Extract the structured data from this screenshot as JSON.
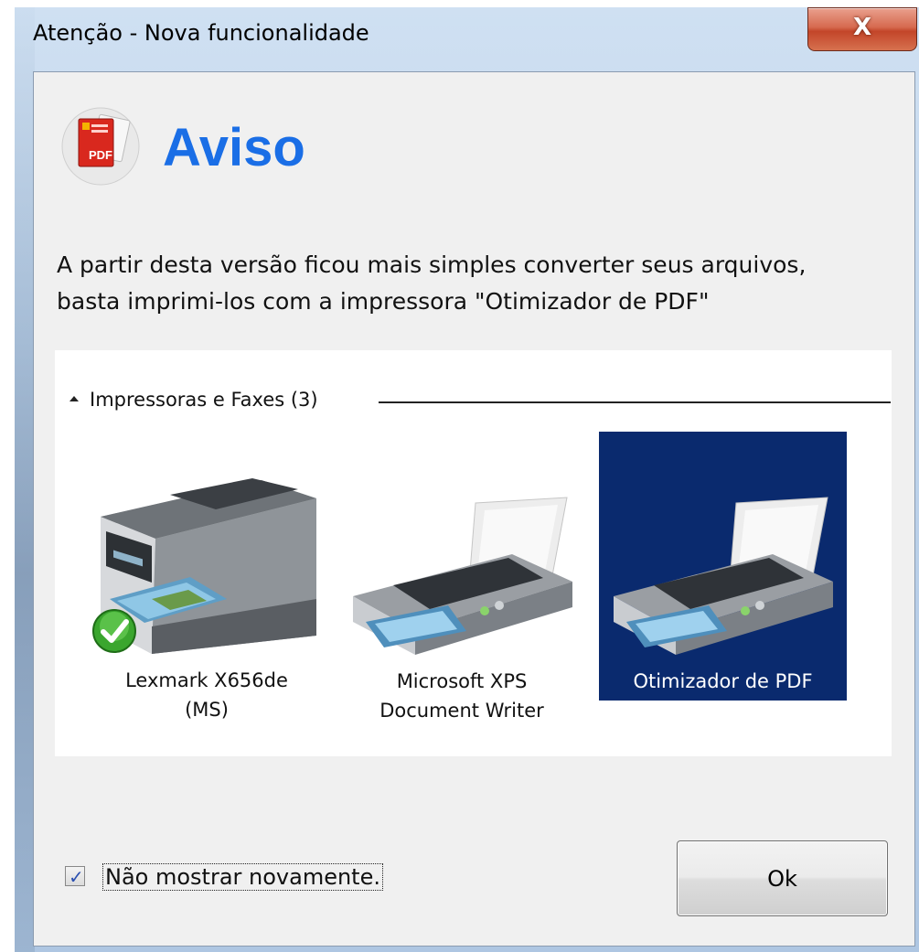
{
  "window": {
    "title": "Atenção - Nova funcionalidade",
    "close_label": "X"
  },
  "header": {
    "heading": "Aviso",
    "icon": "pdf-app-icon"
  },
  "message": {
    "line1": "A partir desta versão ficou mais simples converter seus arquivos,",
    "line2": "basta imprimi-los com a impressora \"Otimizador de PDF\""
  },
  "printers": {
    "group_label": "Impressoras e Faxes (3)",
    "items": [
      {
        "line1": "Lexmark X656de",
        "line2": "(MS)",
        "icon": "multifunction-printer-icon",
        "default": true,
        "selected": false
      },
      {
        "line1": "Microsoft XPS",
        "line2": "Document Writer",
        "icon": "printer-icon",
        "default": false,
        "selected": false
      },
      {
        "line1": "Otimizador de PDF",
        "line2": "",
        "icon": "printer-icon",
        "default": false,
        "selected": true
      }
    ]
  },
  "footer": {
    "dont_show_label": "Não mostrar novamente.",
    "dont_show_checked": true,
    "ok_label": "Ok"
  },
  "colors": {
    "heading": "#1a6ee6",
    "selection": "#0a2a6e",
    "close_button": "#c34529"
  }
}
